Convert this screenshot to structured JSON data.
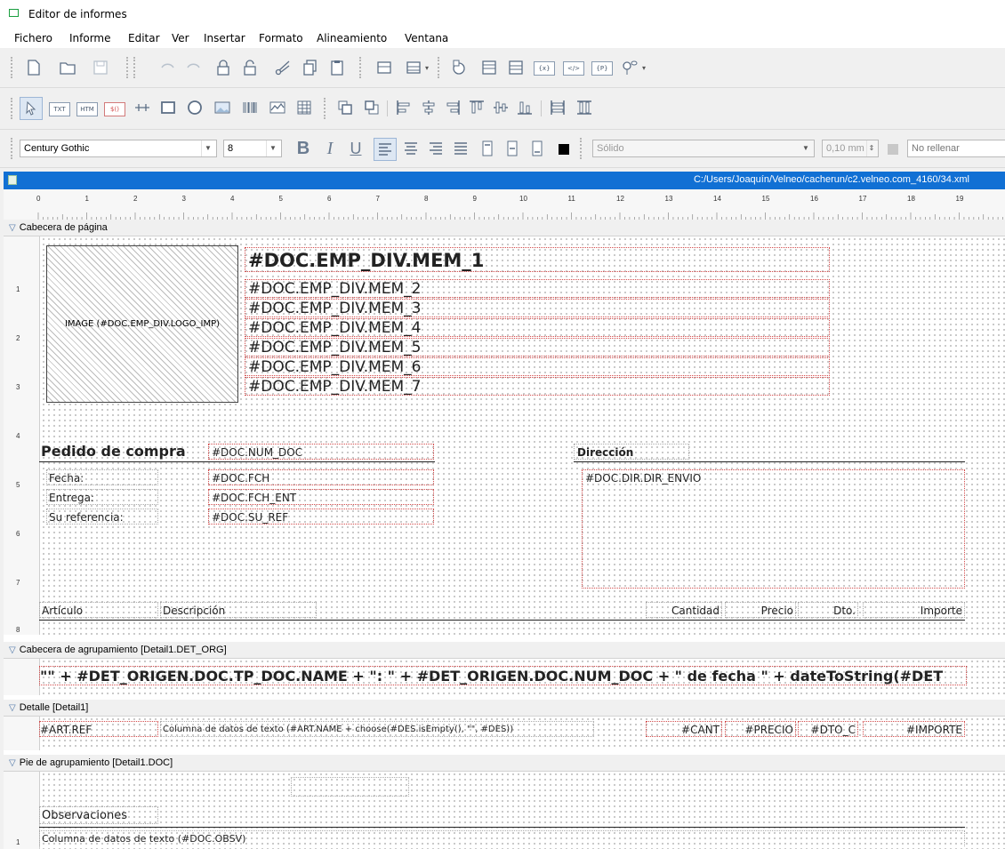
{
  "window": {
    "title": "Editor de informes"
  },
  "menu": [
    "Fichero",
    "Informe",
    "Editar",
    "Ver",
    "Insertar",
    "Formato",
    "Alineamiento",
    "Ventana"
  ],
  "toolbar3": {
    "font": "Century Gothic",
    "size": "8",
    "line_style": "Sólido",
    "line_width": "0,10 mm",
    "fill": "No rellenar"
  },
  "text_tools": {
    "txt": "TXT",
    "htm": "HTM",
    "var": "$()",
    "sql": "{x}",
    "code": "</>",
    "param": "{P}"
  },
  "document": {
    "path": "C:/Users/Joaquín/Velneo/cacherun/c2.velneo.com_4160/34.xml"
  },
  "ruler": [
    "0",
    "1",
    "2",
    "3",
    "4",
    "5",
    "6",
    "7",
    "8",
    "9",
    "10",
    "11",
    "12",
    "13",
    "14",
    "15",
    "16",
    "17",
    "18",
    "19"
  ],
  "sections": {
    "page_header": {
      "title": "Cabecera de página",
      "image": "IMAGE (#DOC.EMP_DIV.LOGO_IMP)",
      "mem1": "#DOC.EMP_DIV.MEM_1",
      "mem": [
        "#DOC.EMP_DIV.MEM_2",
        "#DOC.EMP_DIV.MEM_3",
        "#DOC.EMP_DIV.MEM_4",
        "#DOC.EMP_DIV.MEM_5",
        "#DOC.EMP_DIV.MEM_6",
        "#DOC.EMP_DIV.MEM_7"
      ],
      "order_title": "Pedido de compra",
      "num_doc": "#DOC.NUM_DOC",
      "labels": {
        "fecha": "Fecha:",
        "entrega": "Entrega:",
        "ref": "Su referencia:"
      },
      "fields": {
        "fch": "#DOC.FCH",
        "fch_ent": "#DOC.FCH_ENT",
        "su_ref": "#DOC.SU_REF"
      },
      "direccion": "Dirección",
      "dir_envio": "#DOC.DIR.DIR_ENVIO",
      "columns": {
        "articulo": "Artículo",
        "descripcion": "Descripción",
        "cantidad": "Cantidad",
        "precio": "Precio",
        "dto": "Dto.",
        "importe": "Importe"
      }
    },
    "group_header": {
      "title": "Cabecera de agrupamiento [Detail1.DET_ORG]",
      "expr": "\"\" + #DET_ORIGEN.DOC.TP_DOC.NAME + \": \" + #DET_ORIGEN.DOC.NUM_DOC + \" de fecha \" + dateToString(#DET"
    },
    "detail": {
      "title": "Detalle [Detail1]",
      "art_ref": "#ART.REF",
      "desc": "Columna de datos de texto (#ART.NAME + choose(#DES.isEmpty(), \"\", #DES))",
      "cant": "#CANT",
      "precio": "#PRECIO",
      "dto": "#DTO_C",
      "importe": "#IMPORTE"
    },
    "group_footer": {
      "title": "Pie de agrupamiento [Detail1.DOC]",
      "observaciones": "Observaciones",
      "obsv": "Columna de datos de texto (#DOC.OBSV)"
    }
  }
}
